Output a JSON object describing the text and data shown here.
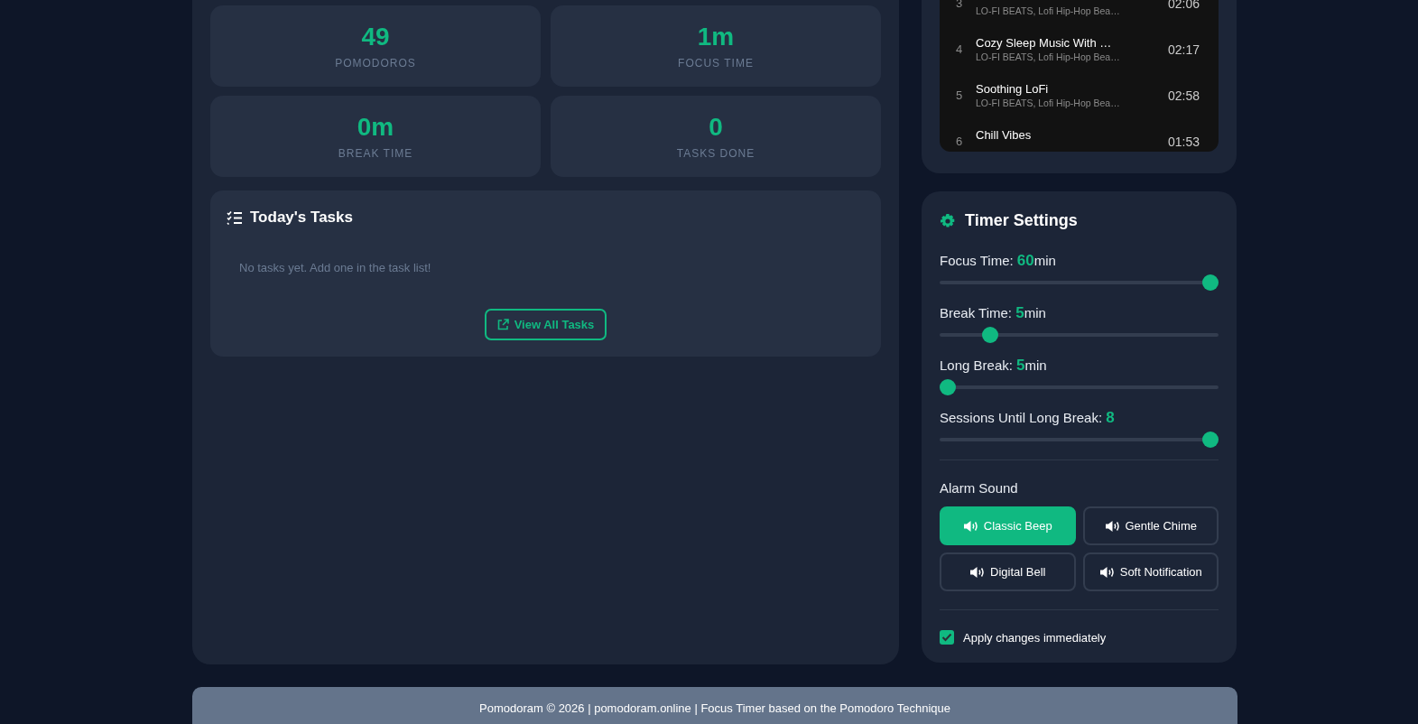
{
  "stats": [
    {
      "value": "49",
      "label": "POMODOROS"
    },
    {
      "value": "1m",
      "label": "FOCUS TIME"
    },
    {
      "value": "0m",
      "label": "BREAK TIME"
    },
    {
      "value": "0",
      "label": "TASKS DONE"
    }
  ],
  "tasks": {
    "title": "Today's Tasks",
    "empty_text": "No tasks yet. Add one in the task list!",
    "button": "View All Tasks"
  },
  "playlist": {
    "tracks": [
      {
        "number": "3",
        "artist": "LO-FI BEATS, Lofi Hip-Hop Bea…",
        "duration": "02:06"
      },
      {
        "number": "4",
        "title": "Cozy Sleep Music With …",
        "artist": "LO-FI BEATS, Lofi Hip-Hop Bea…",
        "duration": "02:17"
      },
      {
        "number": "5",
        "title": "Soothing LoFi",
        "artist": "LO-FI BEATS, Lofi Hip-Hop Bea…",
        "duration": "02:58"
      },
      {
        "number": "6",
        "title": "Chill Vibes",
        "duration": "01:53"
      }
    ]
  },
  "timer_settings": {
    "title": "Timer Settings",
    "sliders": [
      {
        "label": "Focus Time:",
        "value": "60",
        "unit": "min",
        "level": 1
      },
      {
        "label": "Break Time:",
        "value": "5",
        "unit": "min",
        "level": 0.16
      },
      {
        "label": "Long Break:",
        "value": "5",
        "unit": "min",
        "level": 0
      },
      {
        "label": "Sessions Until Long Break:",
        "value": "8",
        "level": 1
      }
    ],
    "alarm_title": "Alarm Sound",
    "alarms": [
      {
        "label": "Classic Beep",
        "selected": true
      },
      {
        "label": "Gentle Chime",
        "selected": false
      },
      {
        "label": "Digital Bell",
        "selected": false
      },
      {
        "label": "Soft Notification",
        "selected": false
      }
    ],
    "apply": {
      "label": "Apply changes immediately",
      "checked": true
    }
  },
  "footer": "Pomodoram © 2026 | pomodoram.online | Focus Timer based on the Pomodoro Technique"
}
